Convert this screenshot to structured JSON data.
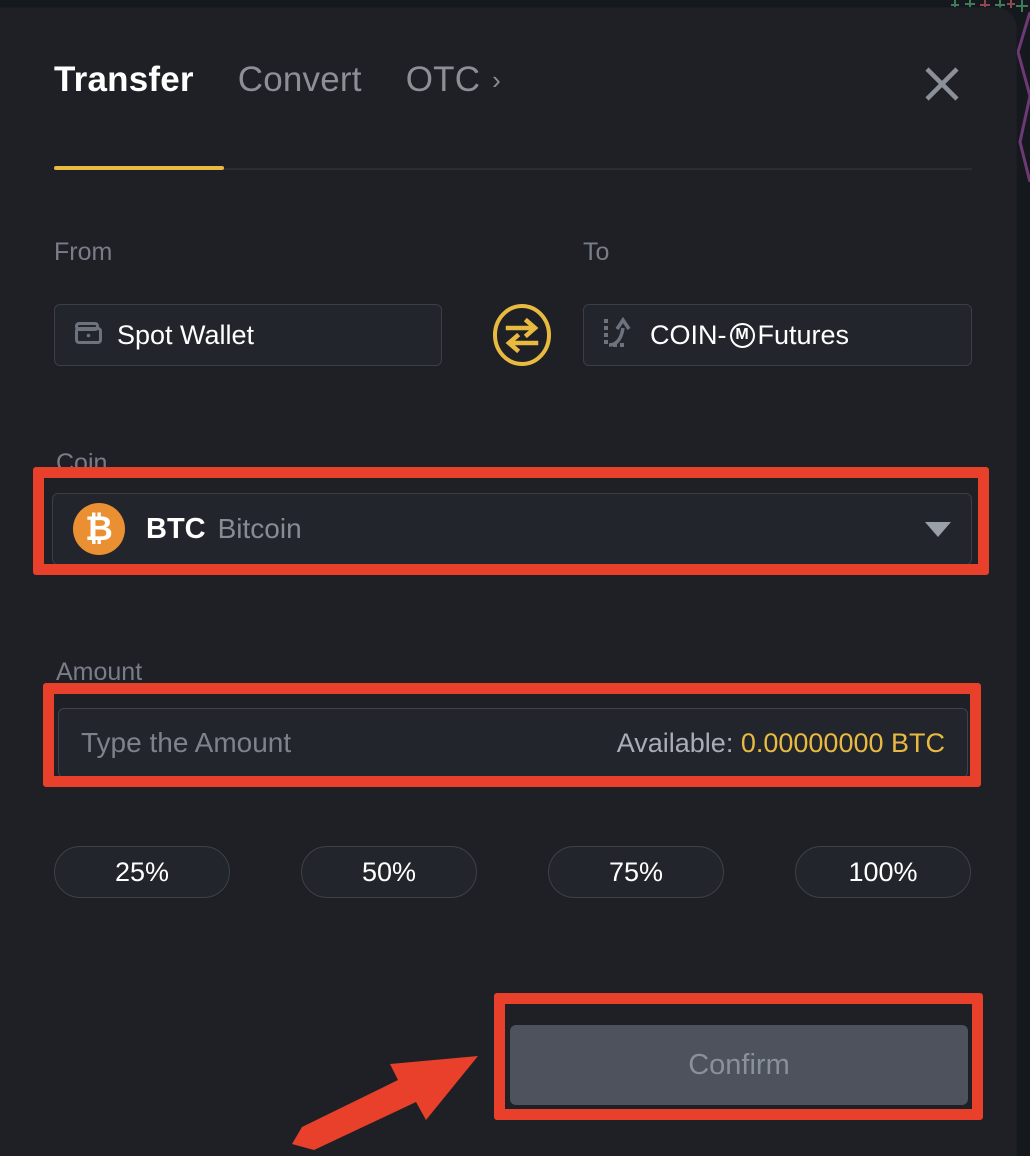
{
  "modal": {
    "tabs": [
      {
        "label": "Transfer",
        "active": true,
        "name": "tab-transfer"
      },
      {
        "label": "Convert",
        "active": false,
        "name": "tab-convert"
      },
      {
        "label": "OTC",
        "active": false,
        "name": "tab-otc",
        "chevron": "›"
      }
    ],
    "close_icon": "close-icon",
    "accent_color": "#e8ba40",
    "background_color": "#1e2026"
  },
  "transfer": {
    "from": {
      "label": "From",
      "value": "Spot Wallet",
      "icon": "wallet-icon"
    },
    "to": {
      "label": "To",
      "value_prefix": "COIN-",
      "value_badge": "M",
      "value_suffix": " Futures",
      "value_full": "COIN-Ⓜ Futures",
      "icon": "futures-growth-icon"
    },
    "swap_icon": "swap-arrows-icon",
    "coin": {
      "label": "Coin",
      "symbol": "BTC",
      "name": "Bitcoin",
      "badge_glyph": "₿",
      "badge_color": "#eb8f33",
      "dropdown_icon": "chevron-down-icon"
    },
    "amount": {
      "label": "Amount",
      "value": "",
      "placeholder": "Type the Amount",
      "available_label": "Available:",
      "available_value": "0.00000000 BTC",
      "available_color": "#e8ba40"
    },
    "percent_buttons": [
      "25%",
      "50%",
      "75%",
      "100%"
    ],
    "confirm": {
      "label": "Confirm",
      "disabled": true
    }
  },
  "annotations": {
    "color": "#e8402a",
    "boxes": [
      "coin-selector",
      "amount-input",
      "confirm-button"
    ],
    "arrow": "points-to-confirm-button"
  }
}
